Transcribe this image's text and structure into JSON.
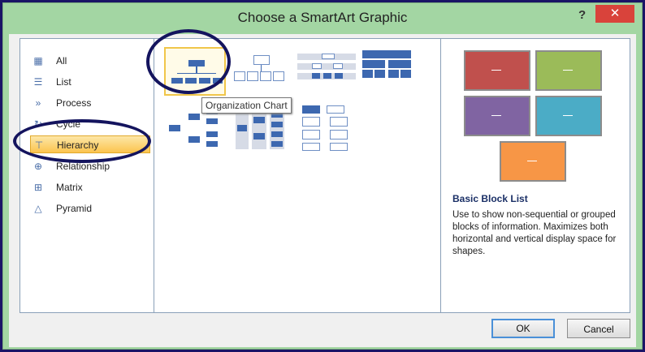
{
  "window": {
    "title": "Choose a SmartArt Graphic",
    "help_label": "?",
    "close_label": "✕"
  },
  "categories": [
    {
      "label": "All",
      "icon": "all-icon"
    },
    {
      "label": "List",
      "icon": "list-icon"
    },
    {
      "label": "Process",
      "icon": "process-icon"
    },
    {
      "label": "Cycle",
      "icon": "cycle-icon"
    },
    {
      "label": "Hierarchy",
      "icon": "hierarchy-icon"
    },
    {
      "label": "Relationship",
      "icon": "relationship-icon"
    },
    {
      "label": "Matrix",
      "icon": "matrix-icon"
    },
    {
      "label": "Pyramid",
      "icon": "pyramid-icon"
    }
  ],
  "selected_category": "Hierarchy",
  "gallery": {
    "tooltip": "Organization Chart"
  },
  "preview": {
    "title": "Basic Block List",
    "description": "Use to show non-sequential or grouped blocks of information. Maximizes both horizontal and vertical display space for shapes.",
    "box_colors": [
      "#c0504d",
      "#9bbb59",
      "#8064a2",
      "#4bacc6",
      "#f79646"
    ]
  },
  "buttons": {
    "ok": "OK",
    "cancel": "Cancel"
  },
  "colors": {
    "accent": "#3d68b0",
    "selection": "#fbc44e",
    "frame": "#a3d6a3",
    "annotation": "#14145e"
  }
}
